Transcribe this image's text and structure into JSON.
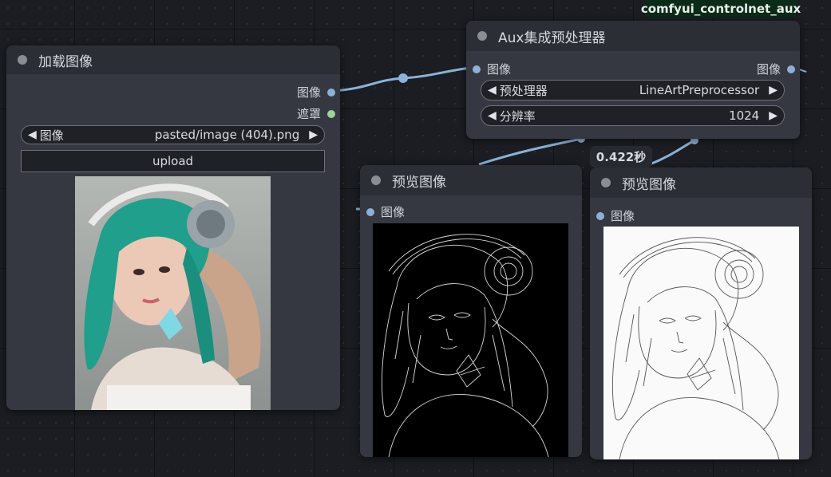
{
  "badge": {
    "label": "comfyui_controlnet_aux"
  },
  "exec_time": "0.422秒",
  "load_node": {
    "title": "加载图像",
    "outputs": [
      "图像",
      "遮罩"
    ],
    "image_widget": {
      "label": "图像",
      "value": "pasted/image (404).png"
    },
    "upload_label": "upload"
  },
  "aux_node": {
    "title": "Aux集成预处理器",
    "input_label": "图像",
    "output_label": "图像",
    "preprocessor_widget": {
      "label": "预处理器",
      "value": "LineArtPreprocessor"
    },
    "resolution_widget": {
      "label": "分辨率",
      "value": "1024"
    }
  },
  "preview_node_1": {
    "title": "预览图像",
    "input_label": "图像"
  },
  "preview_node_2": {
    "title": "预览图像",
    "input_label": "图像"
  },
  "colors": {
    "canvas": "#1b1d22",
    "node_body": "#353840",
    "node_title": "#2b2e35",
    "image_port": "#8eb0d8",
    "mask_port": "#9fd19a",
    "wire": "#8bb2d8",
    "badge_bg": "#0c2a18"
  }
}
